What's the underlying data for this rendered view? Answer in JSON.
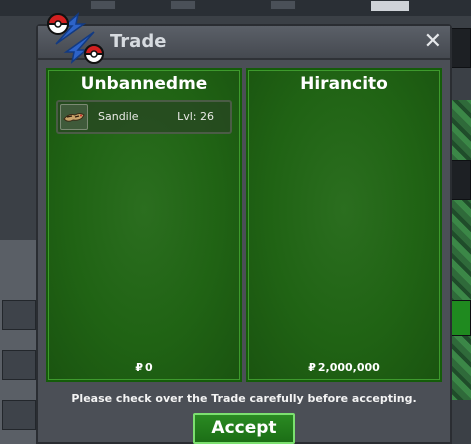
{
  "window": {
    "title": "Trade",
    "close_symbol": "✕"
  },
  "left_offer": {
    "player_name": "Unbannedme",
    "items": [
      {
        "name": "Sandile",
        "level": "Lvl: 26",
        "icon": "sandile-sprite-icon"
      }
    ],
    "currency_symbol": "₽",
    "money": "0"
  },
  "right_offer": {
    "player_name": "Hirancito",
    "items": [],
    "currency_symbol": "₽",
    "money": "2,000,000"
  },
  "footer": {
    "notice": "Please check over the Trade carefully before accepting.",
    "accept_label": "Accept"
  },
  "colors": {
    "panel_green": "#206314",
    "accept_border": "#7ce070",
    "window_bg": "#4b4f56"
  }
}
